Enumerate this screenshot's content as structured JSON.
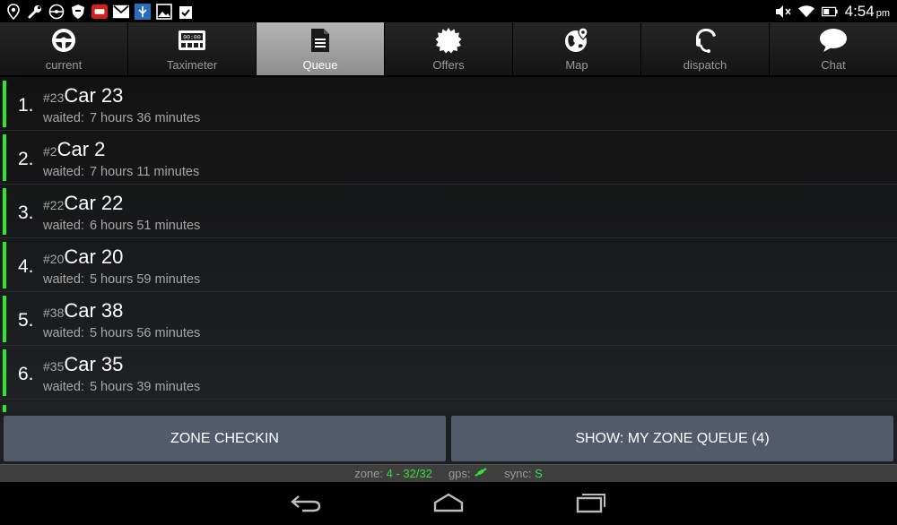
{
  "status_bar": {
    "time": "4:54",
    "ampm": "pm",
    "left_icons": [
      "location-pin-icon",
      "wrench-icon",
      "steering-icon",
      "shield-icon",
      "taxi-app-icon",
      "gmail-icon",
      "usb-icon",
      "gallery-icon",
      "clipboard-check-icon"
    ],
    "right_icons": [
      "mute-icon",
      "wifi-icon",
      "battery-charging-icon"
    ]
  },
  "tabs": [
    {
      "label": "current",
      "icon": "steering-wheel-icon",
      "active": false
    },
    {
      "label": "Taximeter",
      "icon": "taximeter-icon",
      "active": false
    },
    {
      "label": "Queue",
      "icon": "document-icon",
      "active": true
    },
    {
      "label": "Offers",
      "icon": "starburst-icon",
      "active": false
    },
    {
      "label": "Map",
      "icon": "globe-pin-icon",
      "active": false
    },
    {
      "label": "dispatch",
      "icon": "headset-icon",
      "active": false
    },
    {
      "label": "Chat",
      "icon": "speech-bubble-icon",
      "active": false
    }
  ],
  "queue": {
    "waited_label": "waited:",
    "items": [
      {
        "position": "1.",
        "id": "#23",
        "name": "Car 23",
        "waited": "7 hours 36 minutes"
      },
      {
        "position": "2.",
        "id": "#2",
        "name": "Car 2",
        "waited": "7 hours 11 minutes"
      },
      {
        "position": "3.",
        "id": "#22",
        "name": "Car 22",
        "waited": "6 hours 51 minutes"
      },
      {
        "position": "4.",
        "id": "#20",
        "name": "Car 20",
        "waited": "5 hours 59 minutes"
      },
      {
        "position": "5.",
        "id": "#38",
        "name": "Car 38",
        "waited": "5 hours 56 minutes"
      },
      {
        "position": "6.",
        "id": "#35",
        "name": "Car 35",
        "waited": "5 hours 39 minutes"
      }
    ]
  },
  "actions": {
    "zone_checkin": "ZONE CHECKIN",
    "show_queue": "SHOW: MY ZONE QUEUE (4)"
  },
  "info_bar": {
    "zone_label": "zone:",
    "zone_value": "4 - 32/32",
    "gps_label": "gps:",
    "sync_label": "sync:",
    "sync_value": "S"
  },
  "colors": {
    "accent_green": "#2ee62e",
    "active_tab": "#a5a5a5",
    "button": "#525b6a"
  }
}
